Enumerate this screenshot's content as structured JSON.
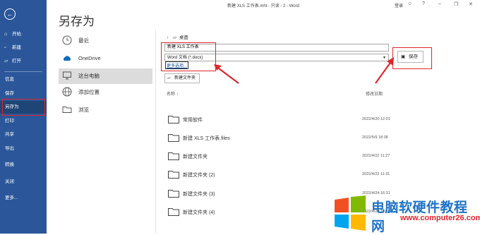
{
  "window": {
    "doc_title": "新建 XLS 工作表.mht - 只读 - 2 - Word",
    "account": "登录",
    "face_icon": "smile-icon",
    "help_icon": "help-icon",
    "minimize_icon": "minimize-icon",
    "restore_icon": "restore-icon",
    "close_icon": "close-icon"
  },
  "nav": {
    "back_icon": "back-arrow-icon",
    "items": [
      {
        "label": "开始",
        "icon": "home-icon"
      },
      {
        "label": "新建",
        "icon": "new-doc-icon"
      },
      {
        "label": "打开",
        "icon": "folder-open-icon"
      },
      {
        "label": "信息"
      },
      {
        "label": "保存"
      },
      {
        "label": "另存为"
      },
      {
        "label": "打印"
      },
      {
        "label": "共享"
      },
      {
        "label": "导出"
      },
      {
        "label": "转换"
      },
      {
        "label": "关闭"
      },
      {
        "label": "更多..."
      }
    ]
  },
  "page": {
    "title": "另存为"
  },
  "locations": [
    {
      "label": "最近",
      "icon": "clock-icon"
    },
    {
      "label": "OneDrive",
      "icon": "cloud-icon"
    },
    {
      "label": "这台电脑",
      "icon": "computer-icon"
    },
    {
      "label": "添加位置",
      "icon": "globe-icon"
    },
    {
      "label": "浏览",
      "icon": "folder-icon"
    }
  ],
  "save_pane": {
    "breadcrumb": "桌面",
    "filename_value": "新建 XLS 工作表",
    "format_value": "Word 文档 (*.docx)",
    "more_options": "更多选项...",
    "save_button": "保存",
    "new_folder_button": "新建文件夹",
    "col_name": "名称 ↑",
    "col_date": "修改日期",
    "rows": [
      {
        "name": "常用软件",
        "date": "2022/4/20 12:01"
      },
      {
        "name": "新建 XLS 工作表.files",
        "date": "2022/5/9 18:38"
      },
      {
        "name": "新建文件夹",
        "date": "2022/4/22 11:27"
      },
      {
        "name": "新建文件夹 (2)",
        "date": "2022/4/22 11:31"
      },
      {
        "name": "新建文件夹 (3)",
        "date": "2022/4/24 16:31"
      },
      {
        "name": "新建文件夹 (4)",
        "date": "2022/4/29 15:30"
      }
    ]
  },
  "watermark": {
    "title": "电脑软硬件教程网",
    "url": "www.computer26.com"
  },
  "colors": {
    "nav_blue": "#2b579a",
    "annotation_red": "#e0262b",
    "watermark_blue": "#1f73c8"
  }
}
